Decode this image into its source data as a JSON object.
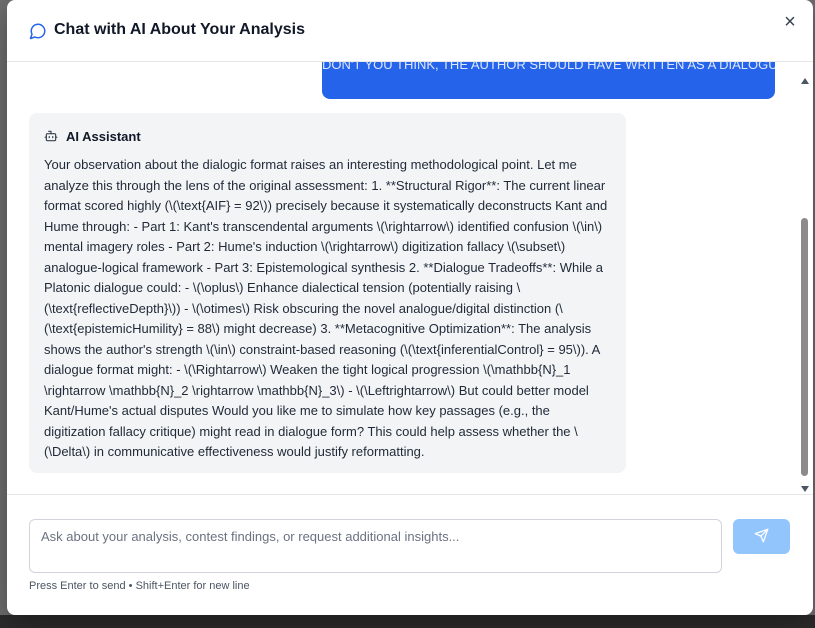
{
  "header": {
    "title": "Chat with AI About Your Analysis",
    "close_label": "×"
  },
  "messages": {
    "user_message": "DON'T YOU THINK, THE AUTHOR SHOULD HAVE WRITTEN AS A DIALOGUE?",
    "assistant_name": "AI Assistant",
    "assistant_text": "Your observation about the dialogic format raises an interesting methodological point. Let me analyze this through the lens of the original assessment: 1. **Structural Rigor**: The current linear format scored highly (\\(\\text{AIF} = 92\\)) precisely because it systematically deconstructs Kant and Hume through: - Part 1: Kant's transcendental arguments \\(\\rightarrow\\) identified confusion \\(\\in\\) mental imagery roles - Part 2: Hume's induction \\(\\rightarrow\\) digitization fallacy \\(\\subset\\) analogue-logical framework - Part 3: Epistemological synthesis 2. **Dialogue Tradeoffs**: While a Platonic dialogue could: - \\(\\oplus\\) Enhance dialectical tension (potentially raising \\(\\text{reflectiveDepth}\\)) - \\(\\otimes\\) Risk obscuring the novel analogue/digital distinction (\\(\\text{epistemicHumility} = 88\\) might decrease) 3. **Metacognitive Optimization**: The analysis shows the author's strength \\(\\in\\) constraint-based reasoning (\\(\\text{inferentialControl} = 95\\)). A dialogue format might: - \\(\\Rightarrow\\) Weaken the tight logical progression \\(\\mathbb{N}_1 \\rightarrow \\mathbb{N}_2 \\rightarrow \\mathbb{N}_3\\) - \\(\\Leftrightarrow\\) But could better model Kant/Hume's actual disputes Would you like me to simulate how key passages (e.g., the digitization fallacy critique) might read in dialogue form? This could help assess whether the \\(\\Delta\\) in communicative effectiveness would justify reformatting."
  },
  "composer": {
    "placeholder": "Ask about your analysis, contest findings, or request additional insights...",
    "value": "",
    "hint": "Press Enter to send • Shift+Enter for new line"
  },
  "icons": {
    "header": "chat-bubble-icon",
    "assistant": "bot-icon",
    "send": "send-icon"
  },
  "colors": {
    "accent": "#2563eb",
    "send_disabled": "#93c5fd",
    "assistant_bg": "#f3f4f6"
  }
}
